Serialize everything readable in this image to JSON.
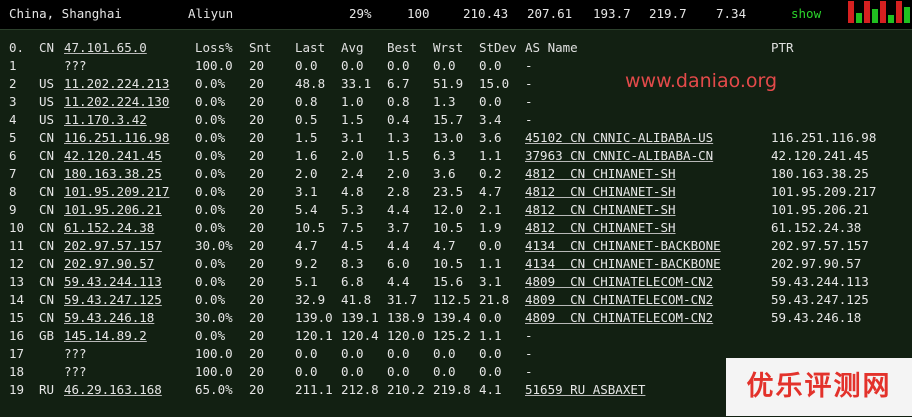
{
  "top": {
    "location": "China, Shanghai",
    "provider": "Aliyun",
    "v1": "29%",
    "v2": "100",
    "v3": "210.43",
    "v4": "207.61",
    "v5": "193.7",
    "v6": "219.7",
    "v7": "7.34",
    "show": "show",
    "spark_colors": [
      "#d62020",
      "#20c020"
    ]
  },
  "headers": [
    "0.",
    "CN",
    "47.101.65.0",
    "Loss%",
    "Snt",
    "Last",
    "Avg",
    "Best",
    "Wrst",
    "StDev",
    "AS Name",
    "PTR"
  ],
  "watermark": "www.daniao.org",
  "logo": "优乐评测网",
  "hops": [
    {
      "n": "1",
      "cc": "",
      "ip": "???",
      "loss": "100.0",
      "snt": "20",
      "last": "0.0",
      "avg": "0.0",
      "best": "0.0",
      "wrst": "0.0",
      "stdev": "0.0",
      "as": "-",
      "ptr": ""
    },
    {
      "n": "2",
      "cc": "US",
      "ip": "11.202.224.213",
      "loss": "0.0%",
      "snt": "20",
      "last": "48.8",
      "avg": "33.1",
      "best": "6.7",
      "wrst": "51.9",
      "stdev": "15.0",
      "as": "-",
      "ptr": ""
    },
    {
      "n": "3",
      "cc": "US",
      "ip": "11.202.224.130",
      "loss": "0.0%",
      "snt": "20",
      "last": "0.8",
      "avg": "1.0",
      "best": "0.8",
      "wrst": "1.3",
      "stdev": "0.0",
      "as": "-",
      "ptr": ""
    },
    {
      "n": "4",
      "cc": "US",
      "ip": "11.170.3.42",
      "loss": "0.0%",
      "snt": "20",
      "last": "0.5",
      "avg": "1.5",
      "best": "0.4",
      "wrst": "15.7",
      "stdev": "3.4",
      "as": "-",
      "ptr": ""
    },
    {
      "n": "5",
      "cc": "CN",
      "ip": "116.251.116.98",
      "loss": "0.0%",
      "snt": "20",
      "last": "1.5",
      "avg": "3.1",
      "best": "1.3",
      "wrst": "13.0",
      "stdev": "3.6",
      "as": "45102 CN CNNIC-ALIBABA-US",
      "ptr": "116.251.116.98"
    },
    {
      "n": "6",
      "cc": "CN",
      "ip": "42.120.241.45",
      "loss": "0.0%",
      "snt": "20",
      "last": "1.6",
      "avg": "2.0",
      "best": "1.5",
      "wrst": "6.3",
      "stdev": "1.1",
      "as": "37963 CN CNNIC-ALIBABA-CN",
      "ptr": "42.120.241.45"
    },
    {
      "n": "7",
      "cc": "CN",
      "ip": "180.163.38.25",
      "loss": "0.0%",
      "snt": "20",
      "last": "2.0",
      "avg": "2.4",
      "best": "2.0",
      "wrst": "3.6",
      "stdev": "0.2",
      "as": "4812  CN CHINANET-SH",
      "ptr": "180.163.38.25"
    },
    {
      "n": "8",
      "cc": "CN",
      "ip": "101.95.209.217",
      "loss": "0.0%",
      "snt": "20",
      "last": "3.1",
      "avg": "4.8",
      "best": "2.8",
      "wrst": "23.5",
      "stdev": "4.7",
      "as": "4812  CN CHINANET-SH",
      "ptr": "101.95.209.217"
    },
    {
      "n": "9",
      "cc": "CN",
      "ip": "101.95.206.21",
      "loss": "0.0%",
      "snt": "20",
      "last": "5.4",
      "avg": "5.3",
      "best": "4.4",
      "wrst": "12.0",
      "stdev": "2.1",
      "as": "4812  CN CHINANET-SH",
      "ptr": "101.95.206.21"
    },
    {
      "n": "10",
      "cc": "CN",
      "ip": "61.152.24.38",
      "loss": "0.0%",
      "snt": "20",
      "last": "10.5",
      "avg": "7.5",
      "best": "3.7",
      "wrst": "10.5",
      "stdev": "1.9",
      "as": "4812  CN CHINANET-SH",
      "ptr": "61.152.24.38"
    },
    {
      "n": "11",
      "cc": "CN",
      "ip": "202.97.57.157",
      "loss": "30.0%",
      "snt": "20",
      "last": "4.7",
      "avg": "4.5",
      "best": "4.4",
      "wrst": "4.7",
      "stdev": "0.0",
      "as": "4134  CN CHINANET-BACKBONE",
      "ptr": "202.97.57.157"
    },
    {
      "n": "12",
      "cc": "CN",
      "ip": "202.97.90.57",
      "loss": "0.0%",
      "snt": "20",
      "last": "9.2",
      "avg": "8.3",
      "best": "6.0",
      "wrst": "10.5",
      "stdev": "1.1",
      "as": "4134  CN CHINANET-BACKBONE",
      "ptr": "202.97.90.57"
    },
    {
      "n": "13",
      "cc": "CN",
      "ip": "59.43.244.113",
      "loss": "0.0%",
      "snt": "20",
      "last": "5.1",
      "avg": "6.8",
      "best": "4.4",
      "wrst": "15.6",
      "stdev": "3.1",
      "as": "4809  CN CHINATELECOM-CN2",
      "ptr": "59.43.244.113"
    },
    {
      "n": "14",
      "cc": "CN",
      "ip": "59.43.247.125",
      "loss": "0.0%",
      "snt": "20",
      "last": "32.9",
      "avg": "41.8",
      "best": "31.7",
      "wrst": "112.5",
      "stdev": "21.8",
      "as": "4809  CN CHINATELECOM-CN2",
      "ptr": "59.43.247.125"
    },
    {
      "n": "15",
      "cc": "CN",
      "ip": "59.43.246.18",
      "loss": "30.0%",
      "snt": "20",
      "last": "139.0",
      "avg": "139.1",
      "best": "138.9",
      "wrst": "139.4",
      "stdev": "0.0",
      "as": "4809  CN CHINATELECOM-CN2",
      "ptr": "59.43.246.18"
    },
    {
      "n": "16",
      "cc": "GB",
      "ip": "145.14.89.2",
      "loss": "0.0%",
      "snt": "20",
      "last": "120.1",
      "avg": "120.4",
      "best": "120.0",
      "wrst": "125.2",
      "stdev": "1.1",
      "as": "-",
      "ptr": ""
    },
    {
      "n": "17",
      "cc": "",
      "ip": "???",
      "loss": "100.0",
      "snt": "20",
      "last": "0.0",
      "avg": "0.0",
      "best": "0.0",
      "wrst": "0.0",
      "stdev": "0.0",
      "as": "-",
      "ptr": ""
    },
    {
      "n": "18",
      "cc": "",
      "ip": "???",
      "loss": "100.0",
      "snt": "20",
      "last": "0.0",
      "avg": "0.0",
      "best": "0.0",
      "wrst": "0.0",
      "stdev": "0.0",
      "as": "-",
      "ptr": ""
    },
    {
      "n": "19",
      "cc": "RU",
      "ip": "46.29.163.168",
      "loss": "65.0%",
      "snt": "20",
      "last": "211.1",
      "avg": "212.8",
      "best": "210.2",
      "wrst": "219.8",
      "stdev": "4.1",
      "as": "51659 RU ASBAXET",
      "ptr": ""
    }
  ]
}
